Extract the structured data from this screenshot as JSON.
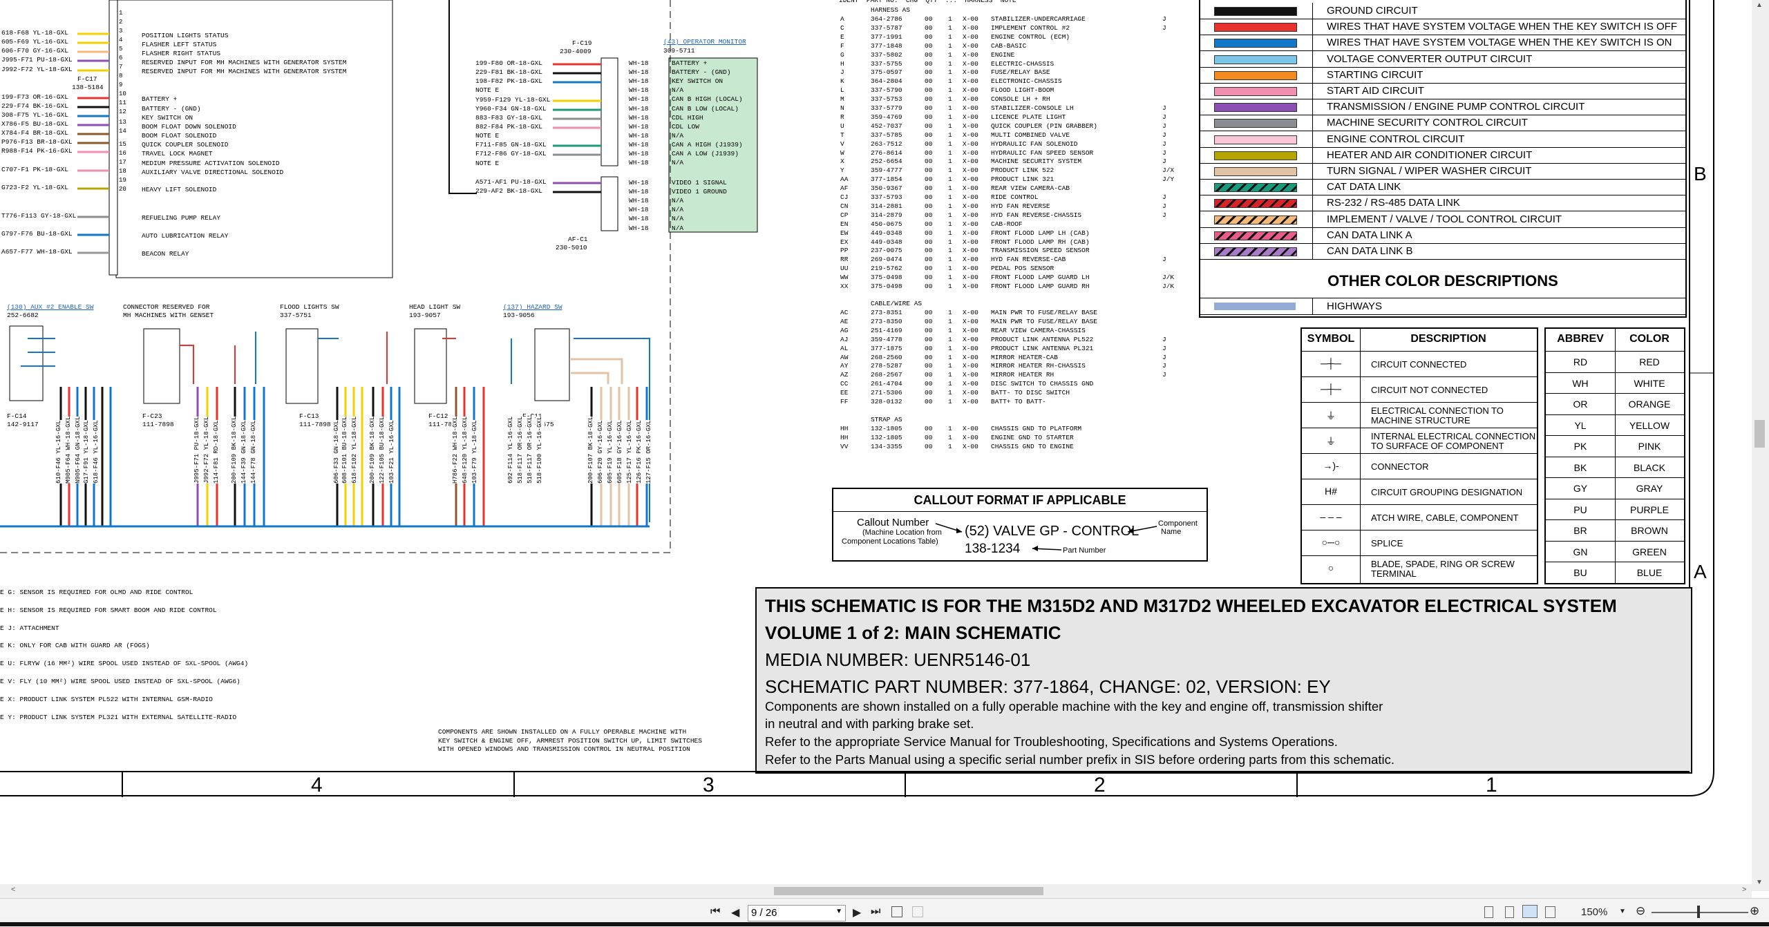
{
  "schematic": {
    "left_block_lines": [
      "618-F68 YL-18-GXL",
      "605-F69 YL-16-GXL",
      "606-F70 GY-16-GXL",
      "J995-F71 PU-18-GXL",
      "J992-F72 YL-18-GXL",
      "F-C17",
      "138-5184",
      "199-F73 OR-16-GXL",
      "229-F74 BK-16-GXL",
      "308-F75 YL-16-GXL",
      "X786-F5 BU-18-GXL",
      "X784-F4 BR-18-GXL",
      "P976-F13 BR-18-GXL",
      "R988-F14 PK-16-GXL",
      "C707-F1 PK-18-GXL",
      "G723-F2 YL-18-GXL",
      "T776-F113 GY-18-GXL",
      "G797-F76 BU-18-GXL",
      "A657-F77 WH-18-GXL"
    ],
    "left_block_descs": [
      "POSITION LIGHTS STATUS",
      "FLASHER LEFT STATUS",
      "FLASHER RIGHT STATUS",
      "RESERVED INPUT FOR MH MACHINES WITH GENERATOR SYSTEM",
      "RESERVED INPUT FOR MH MACHINES WITH GENERATOR SYSTEM",
      "BATTERY +",
      "BATTERY - (GND)",
      "KEY SWITCH ON",
      "BOOM FLOAT DOWN SOLENOID",
      "BOOM FLOAT SOLENOID",
      "QUICK COUPLER SOLENOID",
      "TRAVEL LOCK MAGNET",
      "MEDIUM PRESSURE ACTIVATION SOLENOID",
      "AUXILIARY VALVE DIRECTIONAL SOLENOID",
      "HEAVY LIFT SOLENOID",
      "REFUELING PUMP RELAY",
      "AUTO LUBRICATION RELAY",
      "BEACON RELAY"
    ],
    "monitor": {
      "label": "(43) OPERATOR MONITOR",
      "part": "309-5711",
      "conn": "F-C19",
      "conn_part": "230-4009",
      "wires": [
        "199-F80 OR-18-GXL",
        "229-F81 BK-18-GXL",
        "198-F82 PK-18-GXL",
        "NOTE E",
        "Y959-F129 YL-18-GXL",
        "Y960-F34 GN-18-GXL",
        "883-F83 GY-18-GXL",
        "882-F84 PK-18-GXL",
        "NOTE E",
        "F711-F85 GN-18-GXL",
        "F712-F86 GY-18-GXL",
        "NOTE E",
        "A571-AF1 PU-18-GXL",
        "229-AF2 BK-18-GXL"
      ],
      "pins": [
        "BATTERY +",
        "BATTERY - (GND)",
        "KEY SWITCH ON",
        "N/A",
        "CAN B HIGH (LOCAL)",
        "CAN B LOW (LOCAL)",
        "CDL HIGH",
        "CDL LOW",
        "N/A",
        "CAN A HIGH (J1939)",
        "CAN A LOW (J1939)",
        "N/A",
        "VIDEO 1 SIGNAL",
        "VIDEO 1 GROUND",
        "N/A",
        "N/A",
        "N/A",
        "N/A"
      ],
      "afc": "AF-C1",
      "afc_part": "230-5010"
    },
    "switches": [
      {
        "label": "(130) AUX #2 ENABLE SW",
        "part": "252-6682",
        "conn": "F-C14",
        "conn_part": "142-9117"
      },
      {
        "label": "CONNECTOR RESERVED FOR",
        "label2": "MH MACHINES WITH GENSET",
        "conn": "F-C23",
        "conn_part": "111-7898"
      },
      {
        "label": "FLOOD LIGHTS SW",
        "part": "337-5751",
        "conn": "F-C13",
        "conn_part": "111-7898"
      },
      {
        "label": "HEAD LIGHT SW",
        "part": "193-9057",
        "conn": "F-C12",
        "conn_part": "111-7898"
      },
      {
        "label": "(137) HAZARD SW",
        "part": "193-9056",
        "conn": "F-C11",
        "conn_part": "138-7675"
      }
    ],
    "notes": [
      "E G: SENSOR IS REQUIRED FOR OLMD AND RIDE CONTROL",
      "E H: SENSOR IS REQUIRED FOR SMART BOOM AND RIDE CONTROL",
      "E J: ATTACHMENT",
      "E K: ONLY FOR CAB WITH GUARD AR (FOGS)",
      "E U: FLRYW (16 MM²) WIRE SPOOL USED INSTEAD OF SXL-SPOOL (AWG4)",
      "E V: FLY (10 MM²) WIRE SPOOL USED INSTEAD OF SXL-SPOOL (AWG6)",
      "E X: PRODUCT LINK SYSTEM PL522 WITH INTERNAL GSM-RADIO",
      "E Y: PRODUCT LINK SYSTEM PL321 WITH EXTERNAL SATELLITE-RADIO"
    ],
    "components_note": [
      "COMPONENTS ARE SHOWN INSTALLED ON A FULLY OPERABLE MACHINE WITH",
      "KEY SWITCH & ENGINE OFF, ARMREST POSITION SWITCH UP, LIMIT SWITCHES",
      "WITH OPENED WINDOWS AND TRANSMISSION CONTROL IN NEUTRAL POSITION"
    ],
    "harness_header": "IDENT  PART NO.  CHG  QTY  ...  HARNESS  NOTE",
    "harness_title": "HARNESS AS",
    "harness_rows": [
      [
        "A",
        "364-2786",
        "00",
        "1",
        "X-00",
        "STABILIZER-UNDERCARRIAGE",
        "J"
      ],
      [
        "C",
        "337-5787",
        "00",
        "1",
        "X-00",
        "IMPLEMENT CONTROL #2",
        "J"
      ],
      [
        "E",
        "377-1991",
        "00",
        "1",
        "X-00",
        "ENGINE CONTROL (ECM)",
        ""
      ],
      [
        "F",
        "377-1848",
        "00",
        "1",
        "X-00",
        "CAB-BASIC",
        ""
      ],
      [
        "G",
        "337-5802",
        "00",
        "1",
        "X-00",
        "ENGINE",
        ""
      ],
      [
        "H",
        "337-5755",
        "00",
        "1",
        "X-00",
        "ELECTRIC-CHASSIS",
        ""
      ],
      [
        "J",
        "375-0597",
        "00",
        "1",
        "X-00",
        "FUSE/RELAY BASE",
        ""
      ],
      [
        "K",
        "364-2804",
        "00",
        "1",
        "X-00",
        "ELECTRONIC-CHASSIS",
        ""
      ],
      [
        "L",
        "337-5790",
        "00",
        "1",
        "X-00",
        "FLOOD LIGHT-BOOM",
        ""
      ],
      [
        "M",
        "337-5753",
        "00",
        "1",
        "X-00",
        "CONSOLE LH + RH",
        ""
      ],
      [
        "N",
        "337-5779",
        "00",
        "1",
        "X-00",
        "STABILIZER-CONSOLE LH",
        "J"
      ],
      [
        "R",
        "359-4769",
        "00",
        "1",
        "X-00",
        "LICENCE PLATE LIGHT",
        "J"
      ],
      [
        "U",
        "452-7037",
        "00",
        "1",
        "X-00",
        "QUICK COUPLER (PIN GRABBER)",
        "J"
      ],
      [
        "T",
        "337-5785",
        "00",
        "1",
        "X-00",
        "MULTI COMBINED VALVE",
        "J"
      ],
      [
        "V",
        "263-7512",
        "00",
        "1",
        "X-00",
        "HYDRAULIC FAN SOLENOID",
        "J"
      ],
      [
        "W",
        "276-8614",
        "00",
        "1",
        "X-00",
        "HYDRAULIC FAN SPEED SENSOR",
        "J"
      ],
      [
        "X",
        "252-6654",
        "00",
        "1",
        "X-00",
        "MACHINE SECURITY SYSTEM",
        "J"
      ],
      [
        "Y",
        "359-4777",
        "00",
        "1",
        "X-00",
        "PRODUCT LINK 522",
        "J/X"
      ],
      [
        "AA",
        "377-1854",
        "00",
        "1",
        "X-00",
        "PRODUCT LINK 321",
        "J/Y"
      ],
      [
        "AF",
        "350-9367",
        "00",
        "1",
        "X-00",
        "REAR VIEW CAMERA-CAB",
        ""
      ],
      [
        "CJ",
        "337-5793",
        "00",
        "1",
        "X-00",
        "RIDE CONTROL",
        "J"
      ],
      [
        "CN",
        "314-2881",
        "00",
        "1",
        "X-00",
        "HYD FAN REVERSE",
        "J"
      ],
      [
        "CP",
        "314-2879",
        "00",
        "1",
        "X-00",
        "HYD FAN REVERSE-CHASSIS",
        "J"
      ],
      [
        "EN",
        "450-0675",
        "00",
        "1",
        "X-00",
        "CAB-ROOF",
        ""
      ],
      [
        "EW",
        "449-0348",
        "00",
        "1",
        "X-00",
        "FRONT FLOOD LAMP LH (CAB)",
        ""
      ],
      [
        "EX",
        "449-0348",
        "00",
        "1",
        "X-00",
        "FRONT FLOOD LAMP RH (CAB)",
        ""
      ],
      [
        "PP",
        "237-0075",
        "00",
        "1",
        "X-00",
        "TRANSMISSION SPEED SENSOR",
        ""
      ],
      [
        "RR",
        "269-0474",
        "00",
        "1",
        "X-00",
        "HYD FAN REVERSE-CAB",
        "J"
      ],
      [
        "UU",
        "219-5762",
        "00",
        "1",
        "X-00",
        "PEDAL POS SENSOR",
        ""
      ],
      [
        "WW",
        "375-0498",
        "00",
        "1",
        "X-00",
        "FRONT FLOOD LAMP GUARD LH",
        "J/K"
      ],
      [
        "XX",
        "375-0498",
        "00",
        "1",
        "X-00",
        "FRONT FLOOD LAMP GUARD RH",
        "J/K"
      ]
    ],
    "cable_title": "CABLE/WIRE AS",
    "cable_rows": [
      [
        "AC",
        "273-8351",
        "00",
        "1",
        "X-00",
        "MAIN PWR TO FUSE/RELAY BASE",
        ""
      ],
      [
        "AE",
        "273-8350",
        "00",
        "1",
        "X-00",
        "MAIN PWR TO FUSE/RELAY BASE",
        ""
      ],
      [
        "AG",
        "251-4169",
        "00",
        "1",
        "X-00",
        "REAR VIEW CAMERA-CHASSIS",
        ""
      ],
      [
        "AJ",
        "359-4778",
        "00",
        "1",
        "X-00",
        "PRODUCT LINK ANTENNA PL522",
        "J"
      ],
      [
        "AL",
        "377-1875",
        "00",
        "1",
        "X-00",
        "PRODUCT LINK ANTENNA PL321",
        "J"
      ],
      [
        "AW",
        "268-2560",
        "00",
        "1",
        "X-00",
        "MIRROR HEATER-CAB",
        "J"
      ],
      [
        "AY",
        "278-5287",
        "00",
        "1",
        "X-00",
        "MIRROR HEATER RH-CHASSIS",
        "J"
      ],
      [
        "AZ",
        "268-2567",
        "00",
        "1",
        "X-00",
        "MIRROR HEATER RH",
        "J"
      ],
      [
        "CC",
        "261-4704",
        "00",
        "1",
        "X-00",
        "DISC SWITCH TO CHASSIS GND",
        ""
      ],
      [
        "EE",
        "271-5306",
        "00",
        "1",
        "X-00",
        "BATT- TO DISC SWITCH",
        ""
      ],
      [
        "FF",
        "328-0132",
        "00",
        "1",
        "X-00",
        "BATT+ TO BATT-",
        ""
      ]
    ],
    "strap_title": "STRAP AS",
    "strap_rows": [
      [
        "HH",
        "132-1805",
        "00",
        "1",
        "X-00",
        "CHASSIS GND TO PLATFORM",
        ""
      ],
      [
        "HH",
        "132-1805",
        "00",
        "1",
        "X-00",
        "ENGINE GND TO STARTER",
        ""
      ],
      [
        "VV",
        "134-3355",
        "00",
        "1",
        "X-00",
        "CHASSIS GND TO ENGINE",
        ""
      ]
    ]
  },
  "legend": {
    "rows": [
      {
        "label": "GROUND CIRCUIT",
        "color": "#111111",
        "pattern": "solid"
      },
      {
        "label": "WIRES THAT HAVE SYSTEM VOLTAGE WHEN THE KEY SWITCH IS OFF",
        "color": "#e8322d",
        "pattern": "solid"
      },
      {
        "label": "WIRES THAT HAVE SYSTEM VOLTAGE WHEN THE KEY SWITCH IS ON",
        "color": "#1177c8",
        "pattern": "solid"
      },
      {
        "label": "VOLTAGE CONVERTER OUTPUT CIRCUIT",
        "color": "#7cc6e8",
        "pattern": "solid"
      },
      {
        "label": "STARTING CIRCUIT",
        "color": "#f58a1f",
        "pattern": "solid"
      },
      {
        "label": "START AID CIRCUIT",
        "color": "#f28eb0",
        "pattern": "solid"
      },
      {
        "label": "TRANSMISSION / ENGINE PUMP CONTROL CIRCUIT",
        "color": "#8e4fb5",
        "pattern": "solid"
      },
      {
        "label": "MACHINE SECURITY CONTROL CIRCUIT",
        "color": "#8a8d91",
        "pattern": "solid"
      },
      {
        "label": "ENGINE CONTROL CIRCUIT",
        "color": "#f9c7d8",
        "pattern": "solid"
      },
      {
        "label": "HEATER AND AIR CONDITIONER CIRCUIT",
        "color": "#b8a400",
        "pattern": "solid"
      },
      {
        "label": "TURN SIGNAL / WIPER WASHER CIRCUIT",
        "color": "#e2c3a5",
        "pattern": "solid"
      },
      {
        "label": "CAT DATA LINK",
        "color": "#1a9a7a",
        "pattern": "stripe"
      },
      {
        "label": "RS-232 / RS-485 DATA LINK",
        "color": "#d8232a",
        "pattern": "stripe"
      },
      {
        "label": "IMPLEMENT / VALVE / TOOL CONTROL CIRCUIT",
        "color": "#f6b97a",
        "pattern": "stripe"
      },
      {
        "label": "CAN DATA LINK A",
        "color": "#e85c8a",
        "pattern": "stripe"
      },
      {
        "label": "CAN DATA LINK B",
        "color": "#a77bc8",
        "pattern": "stripe"
      }
    ],
    "other_title": "OTHER COLOR DESCRIPTIONS",
    "other_rows": [
      {
        "label": "HIGHWAYS",
        "color": "#92acd6"
      }
    ]
  },
  "symbols": {
    "header_symbol": "SYMBOL",
    "header_desc": "DESCRIPTION",
    "rows": [
      {
        "sym": "connected",
        "desc": "CIRCUIT CONNECTED"
      },
      {
        "sym": "not-connected",
        "desc": "CIRCUIT NOT CONNECTED"
      },
      {
        "sym": "ground",
        "desc": "ELECTRICAL CONNECTION TO",
        "desc2": "MACHINE STRUCTURE"
      },
      {
        "sym": "internal-ground",
        "desc": "INTERNAL ELECTRICAL CONNECTION",
        "desc2": "TO SURFACE OF COMPONENT"
      },
      {
        "sym": "connector",
        "desc": "CONNECTOR"
      },
      {
        "sym": "H#",
        "desc": "CIRCUIT GROUPING DESIGNATION"
      },
      {
        "sym": "dashes",
        "desc": "ATCH WIRE, CABLE, COMPONENT"
      },
      {
        "sym": "splice",
        "desc": "SPLICE"
      },
      {
        "sym": "blade",
        "desc": "BLADE, SPADE, RING OR SCREW",
        "desc2": "TERMINAL"
      }
    ]
  },
  "abbrev": {
    "header_abbrev": "ABBREV",
    "header_color": "COLOR",
    "rows": [
      [
        "RD",
        "RED"
      ],
      [
        "WH",
        "WHITE"
      ],
      [
        "OR",
        "ORANGE"
      ],
      [
        "YL",
        "YELLOW"
      ],
      [
        "PK",
        "PINK"
      ],
      [
        "BK",
        "BLACK"
      ],
      [
        "GY",
        "GRAY"
      ],
      [
        "PU",
        "PURPLE"
      ],
      [
        "BR",
        "BROWN"
      ],
      [
        "GN",
        "GREEN"
      ],
      [
        "BU",
        "BLUE"
      ]
    ]
  },
  "callout": {
    "title": "CALLOUT FORMAT IF APPLICABLE",
    "callout_number": "Callout Number",
    "callout_sub1": "(Machine Location from",
    "callout_sub2": "Component Locations Table)",
    "example": "(52) VALVE GP - CONTROL",
    "part": "138-1234",
    "part_label": "Part Number",
    "component_name": "Component",
    "component_name2": "Name"
  },
  "titleblock": {
    "line1": "THIS SCHEMATIC IS FOR THE M315D2 AND M317D2  WHEELED EXCAVATOR ELECTRICAL SYSTEM",
    "line2": "VOLUME 1 of 2: MAIN SCHEMATIC",
    "line3": "MEDIA NUMBER: UENR5146-01",
    "line4": "SCHEMATIC PART NUMBER: 377-1864, CHANGE: 02, VERSION: EY",
    "line5": "Components are shown installed on a fully operable machine with the key and engine off, transmission shifter",
    "line6": "in neutral and with parking brake set.",
    "line7": "Refer to the appropriate Service Manual for Troubleshooting, Specifications and Systems Operations.",
    "line8": "Refer to the Parts Manual using a specific serial number prefix in SIS before ordering parts from this schematic."
  },
  "zones": {
    "numbers": [
      "4",
      "3",
      "2",
      "1"
    ],
    "side_b": "B",
    "side_a": "A"
  },
  "viewer": {
    "page_value": "9 / 26",
    "zoom": "150%",
    "btn_first": "⏮",
    "btn_prev": "◀",
    "btn_next": "▶",
    "btn_last": "⏭"
  }
}
